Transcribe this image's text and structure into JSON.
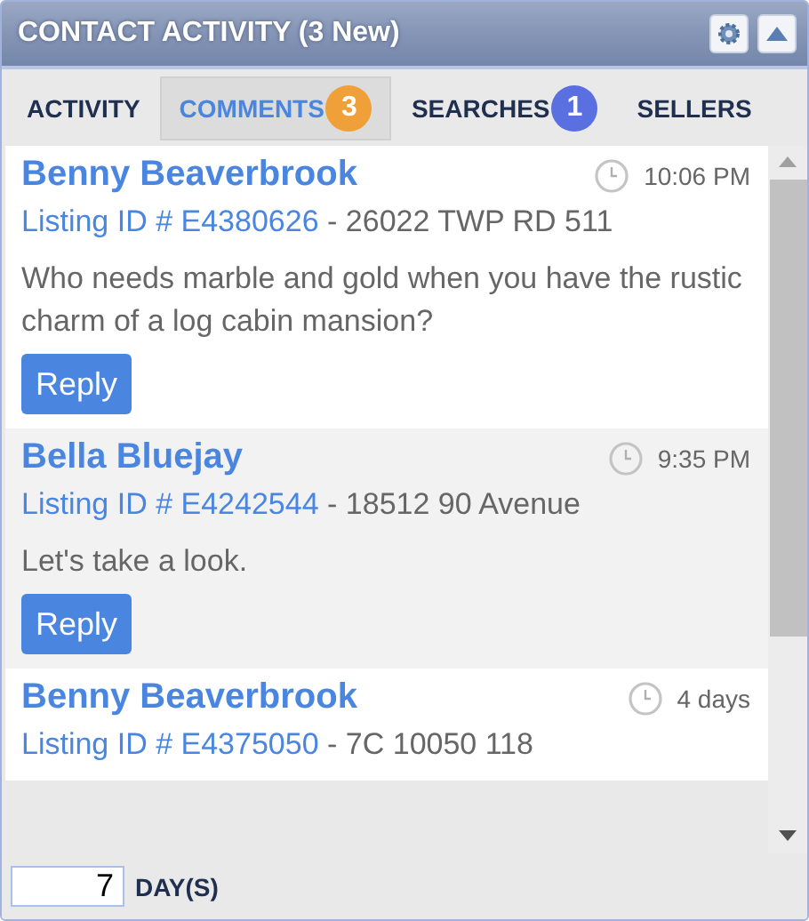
{
  "window": {
    "title": "CONTACT ACTIVITY (3 New)"
  },
  "tabs": [
    {
      "label": "ACTIVITY",
      "selected": false
    },
    {
      "label": "COMMENTS",
      "selected": true,
      "badge": "3",
      "color": "#f0a038"
    },
    {
      "label": "SEARCHES",
      "selected": false,
      "badge": "1",
      "color": "#5a6fe0"
    },
    {
      "label": "SELLERS",
      "selected": false
    }
  ],
  "comments": [
    {
      "name": "Benny Beaverbrook",
      "time": "10:06 PM",
      "listing": "Listing ID # E4380626",
      "address": "- 26022 TWP RD 511",
      "message": "Who needs marble and gold when you have the rustic charm of a log cabin mansion?",
      "button": "Reply"
    },
    {
      "name": "Bella Bluejay",
      "time": "9:35 PM",
      "listing": "Listing ID # E4242544",
      "address": "- 18512 90 Avenue",
      "message": "Let's take a look.",
      "button": "Reply"
    },
    {
      "name": "Benny Beaverbrook",
      "time": "4 days",
      "listing": "Listing ID # E4375050",
      "address": "- 7C 10050 118"
    }
  ],
  "footer": {
    "days": "7",
    "label": "DAY(S)"
  }
}
